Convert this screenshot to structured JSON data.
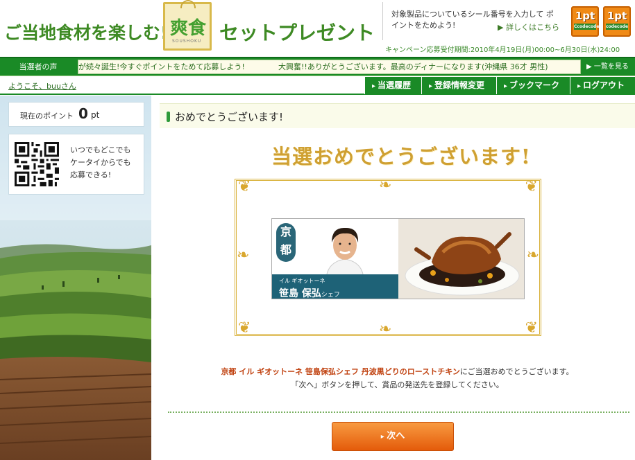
{
  "header": {
    "title_pre": "ご当地食材を楽しむ!",
    "sign_text": "爽食",
    "sign_sub": "SOUSHOKU",
    "title_post": "セットプレゼント",
    "promo_text": "対象製品についているシール番号を入力して ポイントをためよう!",
    "promo_link": "▶ 詳しくはこちら",
    "badge1_num": "1pt",
    "badge1_sub": "Ccodecode",
    "badge2_num": "1pt",
    "badge2_sub": "codecode",
    "period": "キャンペーン応募受付期間:2010年4月19日(月)00:00~6月30日(水)24:00"
  },
  "winners": {
    "label": "当選者の声",
    "ticker_a": "が続々誕生!今すぐポイントをためて応募しよう!",
    "ticker_b": "大興奮!!ありがとうございます。最高のディナーになります(沖縄県 36才 男性)",
    "see_all": "▶ 一覧を見る"
  },
  "userbar": {
    "welcome": "ようこそ、buuさん",
    "nav": [
      "当選履歴",
      "登録情報変更",
      "ブックマーク",
      "ログアウト"
    ]
  },
  "sidebar": {
    "points_label": "現在のポイント",
    "points_value": "0",
    "points_unit": "pt",
    "qr_text_1": "いつでもどこでも",
    "qr_text_2": "ケータイからでも",
    "qr_text_3": "応募できる!"
  },
  "main": {
    "heading": "おめでとうございます!",
    "congrats": "当選おめでとうございます!",
    "prize": {
      "region_1": "京",
      "region_2": "都",
      "chef_role": "イル ギオットーネ",
      "chef_name": "笹島 保弘",
      "chef_suffix": "シェフ"
    },
    "message_highlight": "京都 イル ギオットーネ 笹島保弘シェフ 丹波黒どりのローストチキン",
    "message_rest": "にご当選おめでとうございます。",
    "message_2": "「次へ」ボタンを押して、賞品の発送先を登録してください。",
    "next_label": "次へ"
  }
}
